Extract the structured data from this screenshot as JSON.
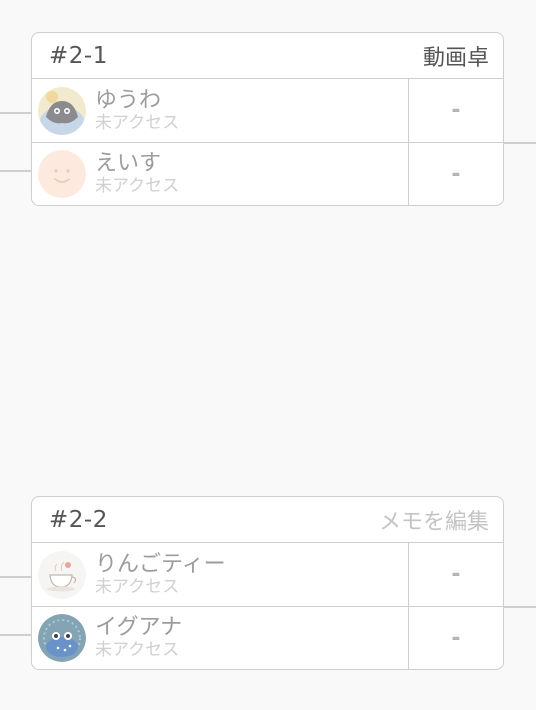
{
  "matches": [
    {
      "id": "#2-1",
      "memo": "動画卓",
      "players": [
        {
          "name": "ゆうわ",
          "status": "未アクセス",
          "score": "-",
          "avatar": "dark-creature-avatar"
        },
        {
          "name": "えいす",
          "status": "未アクセス",
          "score": "-",
          "avatar": "smiley-face-avatar"
        }
      ]
    },
    {
      "id": "#2-2",
      "memo_placeholder": "メモを編集",
      "players": [
        {
          "name": "りんごティー",
          "status": "未アクセス",
          "score": "-",
          "avatar": "teacup-avatar"
        },
        {
          "name": "イグアナ",
          "status": "未アクセス",
          "score": "-",
          "avatar": "iguana-avatar"
        }
      ]
    }
  ]
}
